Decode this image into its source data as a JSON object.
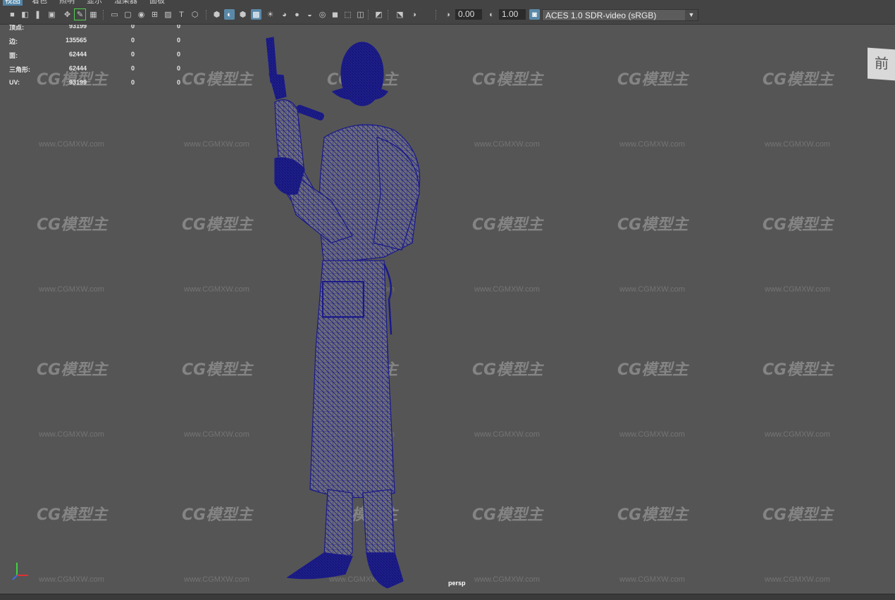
{
  "menu": {
    "items": [
      "视图",
      "着色",
      "照明",
      "显示",
      "渲染器",
      "面板"
    ],
    "active_index": 0
  },
  "toolbar": {
    "exposure_value": "0.00",
    "gamma_value": "1.00",
    "color_space": "ACES 1.0 SDR-video (sRGB)",
    "icons": [
      "camera-icon",
      "camera-attributes-icon",
      "bookmark-icon",
      "image-plane-icon",
      "move-camera-icon",
      "grease-pencil-icon",
      "grid-icon",
      "film-gate-icon",
      "resolution-gate-icon",
      "gate-mask-icon",
      "field-chart-icon",
      "safe-action-icon",
      "safe-title-icon",
      "wireframe-icon",
      "smooth-shade-icon",
      "shade-on-wireframe-icon",
      "wireframe-on-shaded-icon",
      "textured-icon",
      "lights-icon",
      "shadows-icon",
      "screen-space-ao-icon",
      "motion-blur-icon",
      "anti-alias-icon",
      "depth-of-field-icon",
      "isolate-select-icon",
      "xray-icon",
      "xray-joints-icon",
      "backface-culling-icon",
      "exposure-icon",
      "gamma-icon",
      "color-management-icon"
    ]
  },
  "hud": {
    "rows": [
      {
        "label": "顶点:",
        "v1": "93199",
        "v2": "0",
        "v3": "0"
      },
      {
        "label": "边:",
        "v1": "135565",
        "v2": "0",
        "v3": "0"
      },
      {
        "label": "面:",
        "v1": "62444",
        "v2": "0",
        "v3": "0"
      },
      {
        "label": "三角形:",
        "v1": "62444",
        "v2": "0",
        "v3": "0"
      },
      {
        "label": "UV:",
        "v1": "93199",
        "v2": "0",
        "v3": "0"
      }
    ]
  },
  "viewport": {
    "camera_label": "persp",
    "view_cube_label": "前",
    "background_color": "#555556",
    "wireframe_color": "#1a1a8a"
  },
  "watermark": {
    "logo_text": "CG模型主",
    "url_text": "www.CGMXW.com"
  }
}
